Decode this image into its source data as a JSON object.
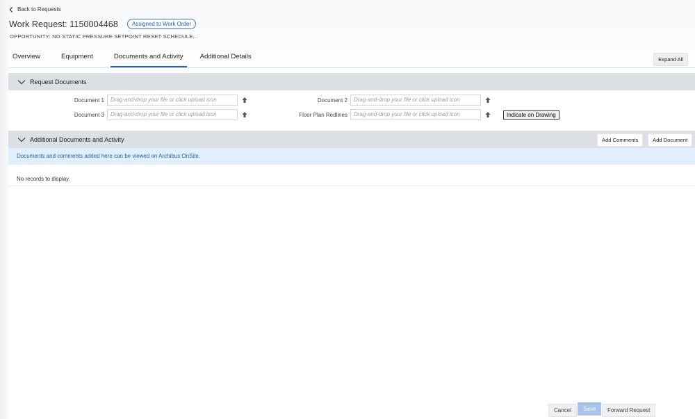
{
  "nav": {
    "back_label": "Back to Requests"
  },
  "header": {
    "title": "Work Request: 1150004468",
    "status_badge": "Assigned to Work Order",
    "subtitle": "OPPORTUNITY: NO STATIC PRESSURE SETPOINT RESET SCHEDULE..."
  },
  "tabs": [
    {
      "label": "Overview"
    },
    {
      "label": "Equipment"
    },
    {
      "label": "Documents and Activity",
      "active": true
    },
    {
      "label": "Additional Details"
    }
  ],
  "expand_all_label": "Expand All",
  "request_documents": {
    "title": "Request Documents",
    "fields": [
      {
        "label": "Document 1",
        "placeholder": "Drag-and-drop your file or click upload icon"
      },
      {
        "label": "Document 2",
        "placeholder": "Drag-and-drop your file or click upload icon"
      },
      {
        "label": "Document 3",
        "placeholder": "Drag-and-drop your file or click upload icon"
      },
      {
        "label": "Floor Plan Redlines",
        "placeholder": "Drag-and-drop your file or click upload icon"
      }
    ],
    "indicate_label": "Indicate on Drawing"
  },
  "additional_documents": {
    "title": "Additional Documents and Activity",
    "add_comments_label": "Add Comments",
    "add_document_label": "Add Document",
    "info_text": "Documents and comments added here can be viewed on Archibus OnSite.",
    "empty_text": "No records to display."
  },
  "footer": {
    "cancel_label": "Cancel",
    "save_label": "Save",
    "forward_label": "Forward Request"
  },
  "colors": {
    "accent": "#2a5db0",
    "section_header_bg": "#dcdfe3",
    "info_banner_bg": "#e1f0fc",
    "save_disabled_bg": "#a8c3ec"
  },
  "icons": [
    "chevron-left-icon",
    "chevron-down-icon",
    "upload-arrow-icon"
  ]
}
